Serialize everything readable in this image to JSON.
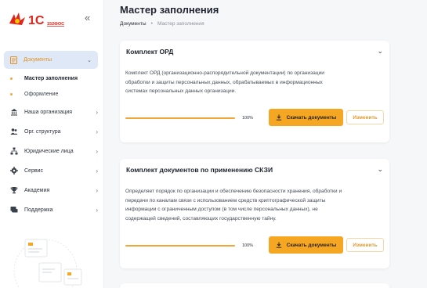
{
  "brand": {
    "logo_text": "1С",
    "logo_sub": "152ФОС"
  },
  "sidebar": {
    "active": {
      "label": "Документы"
    },
    "sub_items": [
      {
        "label": "Мастер заполнения"
      },
      {
        "label": "Оформление"
      }
    ],
    "items": [
      {
        "label": "Наша организация"
      },
      {
        "label": "Орг. структура"
      },
      {
        "label": "Юридические лица"
      },
      {
        "label": "Сервис"
      },
      {
        "label": "Академия"
      },
      {
        "label": "Поддержка"
      }
    ]
  },
  "page": {
    "title": "Мастер заполнения",
    "breadcrumb": [
      "Документы",
      "Мастер заполнения"
    ]
  },
  "cards": [
    {
      "title": "Комплект ОРД",
      "text": [
        "Комплект ОРД (организационно-распорядительной документации) по организации",
        "обработки и защиты персональных данных, обрабатываемых в информационных",
        "системах персональных данных организации."
      ],
      "progress": 100,
      "progress_label": "100%",
      "download_label": "Скачать документы",
      "edit_label": "Изменить"
    },
    {
      "title": "Комплект документов по применению СКЗИ",
      "text": [
        "Определяет порядок по организации и обеспечению безопасности хранения, обработки и",
        "передачи по каналам связи с использованием средств криптографической защиты",
        "информации с ограниченным доступом (в том числе персональных данных), не",
        "содержащей сведений, составляющих государственную тайну."
      ],
      "progress": 100,
      "progress_label": "100%",
      "download_label": "Скачать документы",
      "edit_label": "Изменить"
    }
  ],
  "colors": {
    "accent": "#f5a623",
    "active_bg": "#dfe8f7",
    "active_text": "#e0922a"
  }
}
